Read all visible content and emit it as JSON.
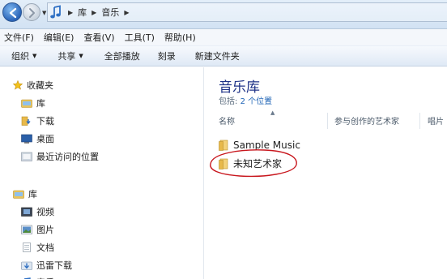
{
  "address_bar": {
    "crumbs": [
      "库",
      "音乐"
    ]
  },
  "menu": [
    "文件(F)",
    "编辑(E)",
    "查看(V)",
    "工具(T)",
    "帮助(H)"
  ],
  "toolbar": {
    "organize": "组织",
    "share": "共享",
    "play_all": "全部播放",
    "burn": "刻录",
    "new_folder": "新建文件夹"
  },
  "nav": {
    "favorites": "收藏夹",
    "fav_items": [
      "库",
      "下载",
      "桌面",
      "最近访问的位置"
    ],
    "libraries": "库",
    "lib_items": [
      "视频",
      "图片",
      "文档",
      "迅雷下载"
    ],
    "partial": "音乐"
  },
  "content": {
    "title": "音乐库",
    "includes_label": "包括:",
    "includes_link": "2 个位置",
    "columns": [
      "名称",
      "参与创作的艺术家",
      "唱片"
    ],
    "rows": [
      "Sample Music",
      "未知艺术家"
    ]
  },
  "colors": {
    "title_blue": "#1e3287",
    "link_blue": "#1f64b6",
    "annotation_red": "#c8161d",
    "folder_yellow": "#e8b94a"
  }
}
